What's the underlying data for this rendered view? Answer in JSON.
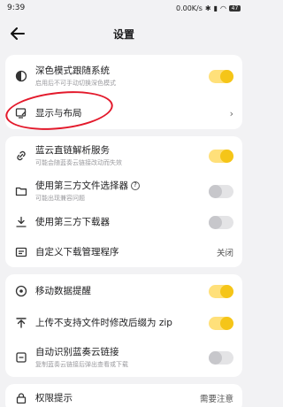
{
  "status": {
    "time": "9:39",
    "net": "0.00K/s",
    "battery": "47"
  },
  "header": {
    "title": "设置"
  },
  "card1": {
    "dark_mode": {
      "label": "深色模式跟随系统",
      "sub": "启用后不可手动切换深色模式",
      "on": true
    },
    "display_layout": {
      "label": "显示与布局",
      "chevron": "›"
    }
  },
  "card2": {
    "lanzou_dns": {
      "label": "蓝云直链解析服务",
      "sub": "可能会随蓝奏云链接改动而失效",
      "on": true
    },
    "third_party_picker": {
      "label": "使用第三方文件选择器",
      "help": "?",
      "sub": "可能出现兼容问题",
      "on": false
    },
    "third_party_downloader": {
      "label": "使用第三方下载器",
      "on": false
    },
    "custom_download_mgr": {
      "label": "自定义下载管理程序",
      "value": "关闭"
    }
  },
  "card3": {
    "mobile_data_alert": {
      "label": "移动数据提醒",
      "on": true
    },
    "zip_suffix": {
      "label": "上传不支持文件时修改后缀为 zip",
      "on": true
    },
    "auto_detect_link": {
      "label": "自动识别蓝奏云链接",
      "sub": "复制蓝奏云链接后弹出查看或下载",
      "on": false
    }
  },
  "card4": {
    "permission_tip": {
      "label": "权限提示",
      "value": "需要注意"
    }
  },
  "colors": {
    "accent": "#f5c518",
    "highlight": "#e3192b"
  }
}
